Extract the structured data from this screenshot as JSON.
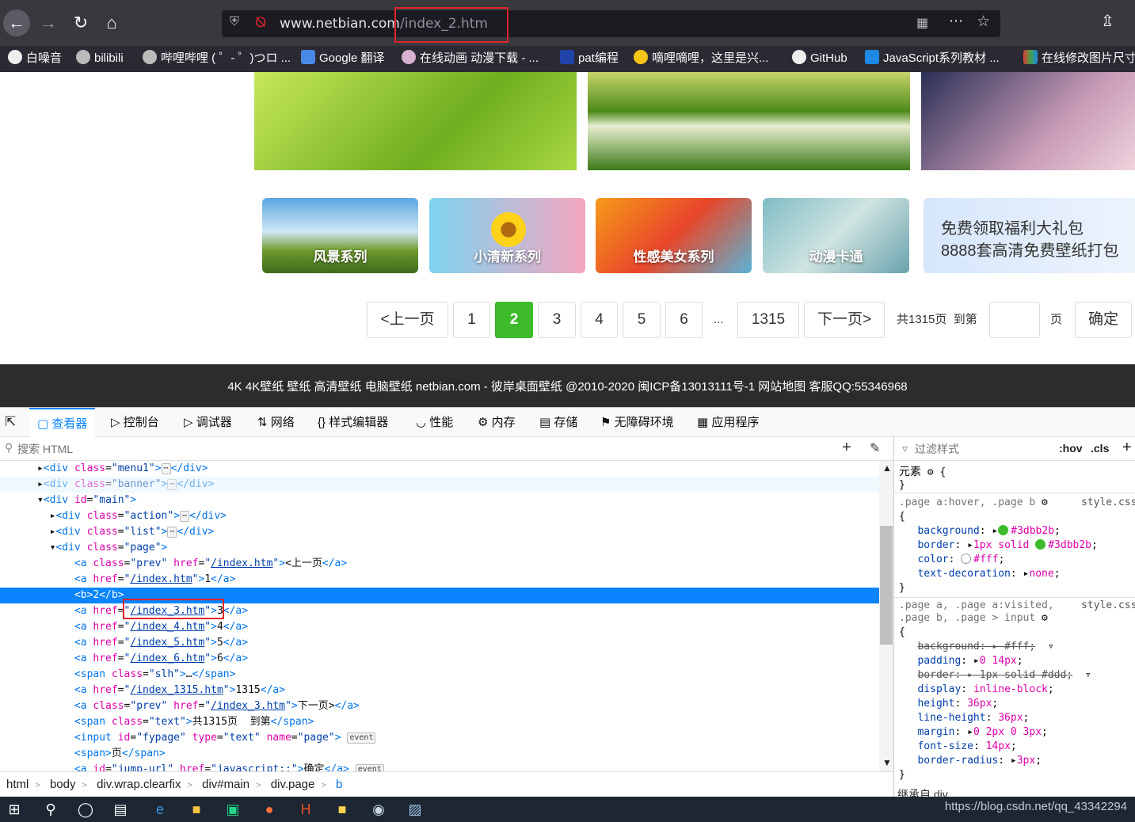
{
  "browser": {
    "url_domain": "www.netbian.com",
    "url_path": "/index_2.htm",
    "bookmarks": [
      "白噪音",
      "bilibili",
      "哔哩哔哩 ( ゜- ゜)つロ ...",
      "Google 翻译",
      "在线动画 动漫下载 - ...",
      "pat编程",
      "嘀哩嘀哩，这里是兴...",
      "GitHub",
      "JavaScript系列教材 ...",
      "在线修改图片尺寸"
    ]
  },
  "page": {
    "categories": [
      "风景系列",
      "小清新系列",
      "性感美女系列",
      "动漫卡通"
    ],
    "promo_line1": "免费领取福利大礼包",
    "promo_line2": "8888套高清免费壁纸打包",
    "pager": {
      "prev": "<上一页",
      "pages": [
        "1",
        "2",
        "3",
        "4",
        "5",
        "6"
      ],
      "current": "2",
      "ellipsis": "...",
      "last": "1315",
      "next": "下一页>",
      "total_text": "共1315页  到第",
      "page_unit": "页",
      "confirm": "确定"
    },
    "footer": "4K 4K壁纸 壁纸 高清壁纸 电脑壁纸 netbian.com - 彼岸桌面壁纸 @2010-2020 闽ICP备13013111号-1 网站地图 客服QQ:55346968"
  },
  "devtools": {
    "tabs": [
      "查看器",
      "控制台",
      "调试器",
      "网络",
      "样式编辑器",
      "性能",
      "内存",
      "存储",
      "无障碍环境",
      "应用程序"
    ],
    "search_placeholder": "搜索 HTML",
    "filter_placeholder": "过滤样式",
    "hov": ":hov",
    "cls": ".cls",
    "breadcrumbs": [
      "html",
      "body",
      "div.wrap.clearfix",
      "div#main",
      "div.page",
      "b"
    ],
    "element_label": "元素",
    "rule1_selector": ".page a:hover, .page b",
    "rule_source": "style.css",
    "rule2_selector_1": ".page a, .page a:visited,",
    "rule2_selector_2": ".page b, .page > input",
    "inherit_label": "继承自 div",
    "colors": {
      "green": "#3dbb2b",
      "accent": "#0a84ff"
    }
  },
  "watermark": "https://blog.csdn.net/qq_43342294"
}
